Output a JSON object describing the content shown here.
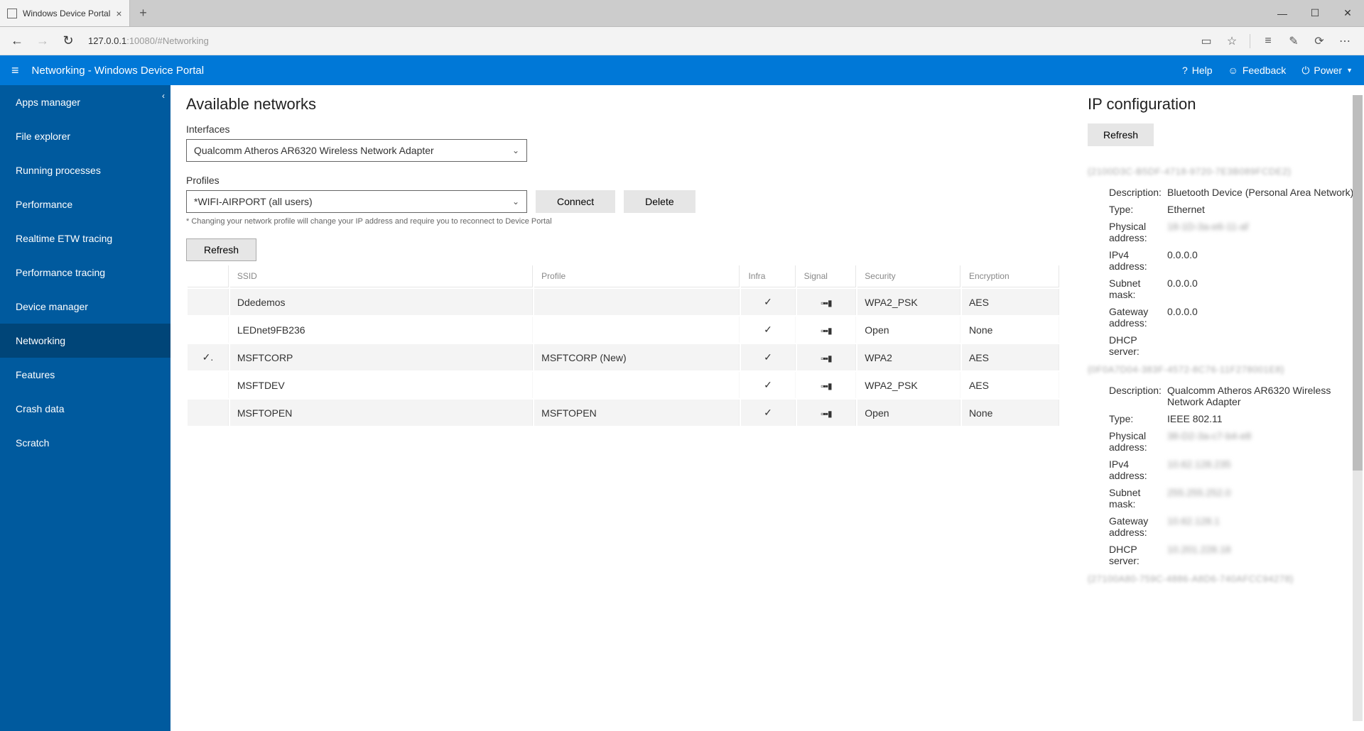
{
  "chrome": {
    "tab_title": "Windows Device Portal",
    "address_host": "127.0.0.1",
    "address_rest": ":10080/#Networking"
  },
  "header": {
    "title": "Networking - Windows Device Portal",
    "help": "Help",
    "feedback": "Feedback",
    "power": "Power"
  },
  "sidebar": {
    "items": [
      "Apps manager",
      "File explorer",
      "Running processes",
      "Performance",
      "Realtime ETW tracing",
      "Performance tracing",
      "Device manager",
      "Networking",
      "Features",
      "Crash data",
      "Scratch"
    ],
    "active_index": 7
  },
  "available_networks": {
    "title": "Available networks",
    "interfaces_label": "Interfaces",
    "interfaces_value": "Qualcomm Atheros AR6320 Wireless Network Adapter",
    "profiles_label": "Profiles",
    "profiles_value": "*WIFI-AIRPORT (all users)",
    "connect": "Connect",
    "delete": "Delete",
    "hint": "* Changing your network profile will change your IP address and require you to reconnect to Device Portal",
    "refresh": "Refresh",
    "columns": [
      "SSID",
      "Profile",
      "Infra",
      "Signal",
      "Security",
      "Encryption"
    ],
    "rows": [
      {
        "ssid": "Ddedemos",
        "profile": "",
        "infra": true,
        "security": "WPA2_PSK",
        "encryption": "AES",
        "selected": false
      },
      {
        "ssid": "LEDnet9FB236",
        "profile": "",
        "infra": true,
        "security": "Open",
        "encryption": "None",
        "selected": false
      },
      {
        "ssid": "MSFTCORP",
        "profile": "MSFTCORP (New)",
        "infra": true,
        "security": "WPA2",
        "encryption": "AES",
        "selected": true
      },
      {
        "ssid": "MSFTDEV",
        "profile": "",
        "infra": true,
        "security": "WPA2_PSK",
        "encryption": "AES",
        "selected": false
      },
      {
        "ssid": "MSFTOPEN",
        "profile": "MSFTOPEN",
        "infra": true,
        "security": "Open",
        "encryption": "None",
        "selected": false
      }
    ]
  },
  "ip_config": {
    "title": "IP configuration",
    "refresh": "Refresh",
    "adapters": [
      {
        "id_masked": "{2100D3C-B5DF-4718-9720-7E3B089FCDE2}",
        "desc": "Bluetooth Device (Personal Area Network)",
        "type": "Ethernet",
        "phys_masked": "18-1D-3a-e6-11-af",
        "ipv4": "0.0.0.0",
        "mask": "0.0.0.0",
        "gateway": "0.0.0.0",
        "dhcp": ""
      },
      {
        "id_masked": "{0F0A7D04-383F-4572-8C76-11F278001E8}",
        "desc": "Qualcomm Atheros AR6320 Wireless Network Adapter",
        "type": "IEEE 802.11",
        "phys_masked": "38-D2-3a-c7-b4-e8",
        "ipv4": "10.62.128.235",
        "mask": "255.255.252.0",
        "gateway": "10.62.128.1",
        "dhcp": "10.201.228.18"
      },
      {
        "id_masked": "{27100A80-759C-4886-A8D6-740AFCC94278}"
      }
    ],
    "labels": {
      "desc": "Description:",
      "type": "Type:",
      "phys": "Physical address:",
      "ipv4": "IPv4 address:",
      "mask": "Subnet mask:",
      "gateway": "Gateway address:",
      "dhcp": "DHCP server:"
    }
  }
}
